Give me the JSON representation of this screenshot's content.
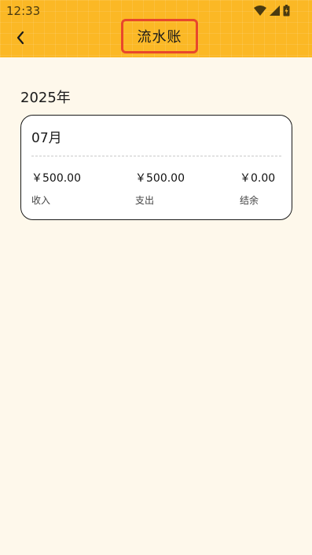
{
  "status_bar": {
    "time": "12:33",
    "icons": [
      "wifi-icon",
      "signal-icon",
      "battery-icon"
    ]
  },
  "header": {
    "back_icon": "chevron-left-icon",
    "title": "流水账",
    "bg_color": "#FBB825",
    "highlight_color": "#E8472C"
  },
  "year_label": "2025年",
  "month_card": {
    "month": "07月",
    "stats": [
      {
        "amount": "￥500.00",
        "label": "收入"
      },
      {
        "amount": "￥500.00",
        "label": "支出"
      },
      {
        "amount": "￥0.00",
        "label": "结余"
      }
    ]
  },
  "page_bg": "#FEF8EB"
}
